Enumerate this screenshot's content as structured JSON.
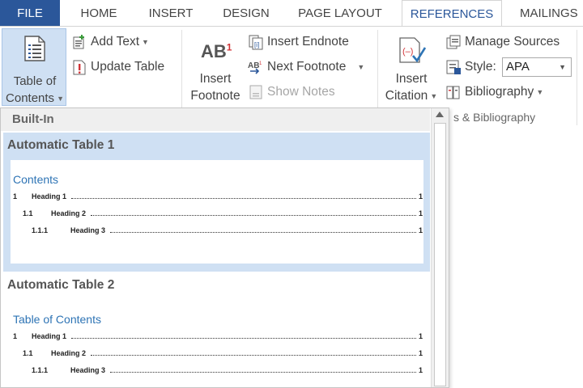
{
  "tabs": {
    "file": "FILE",
    "home": "HOME",
    "insert": "INSERT",
    "design": "DESIGN",
    "page_layout": "PAGE LAYOUT",
    "references": "REFERENCES",
    "mailings": "MAILINGS"
  },
  "ribbon": {
    "toc_label_line1": "Table of",
    "toc_label_line2": "Contents",
    "add_text": "Add Text",
    "update_table": "Update Table",
    "insert_footnote_icon_text": "AB",
    "insert_footnote_sup": "1",
    "insert_footnote_line1": "Insert",
    "insert_footnote_line2": "Footnote",
    "insert_endnote": "Insert Endnote",
    "next_footnote": "Next Footnote",
    "show_notes": "Show Notes",
    "insert_citation_line1": "Insert",
    "insert_citation_line2": "Citation",
    "manage_sources": "Manage Sources",
    "style_label": "Style:",
    "style_value": "APA",
    "bibliography": "Bibliography",
    "citations_group_label": "s & Bibliography"
  },
  "gallery": {
    "section_header": "Built-In",
    "entries": [
      {
        "title": "Automatic Table 1",
        "heading": "Contents",
        "lines": [
          {
            "num": "1",
            "text": "Heading 1",
            "page": "1"
          },
          {
            "num": "1.1",
            "text": "Heading 2",
            "page": "1"
          },
          {
            "num": "1.1.1",
            "text": "Heading 3",
            "page": "1"
          }
        ]
      },
      {
        "title": "Automatic Table 2",
        "heading": "Table of Contents",
        "lines": [
          {
            "num": "1",
            "text": "Heading 1",
            "page": "1"
          },
          {
            "num": "1.1",
            "text": "Heading 2",
            "page": "1"
          },
          {
            "num": "1.1.1",
            "text": "Heading 3",
            "page": "1"
          }
        ]
      }
    ]
  },
  "colors": {
    "file_tab": "#2b579a",
    "active_tab_text": "#2b579a",
    "selected_entry": "#cfe0f3",
    "toc_heading": "#2e74b5"
  },
  "icons": {
    "toc": "document-lines-icon",
    "add_text": "add-text-icon",
    "update_table": "update-table-icon",
    "insert_endnote": "insert-endnote-icon",
    "next_footnote": "next-footnote-icon",
    "show_notes": "show-notes-icon",
    "insert_citation": "citation-icon",
    "manage_sources": "manage-sources-icon",
    "style": "style-icon",
    "bibliography": "bibliography-icon"
  }
}
